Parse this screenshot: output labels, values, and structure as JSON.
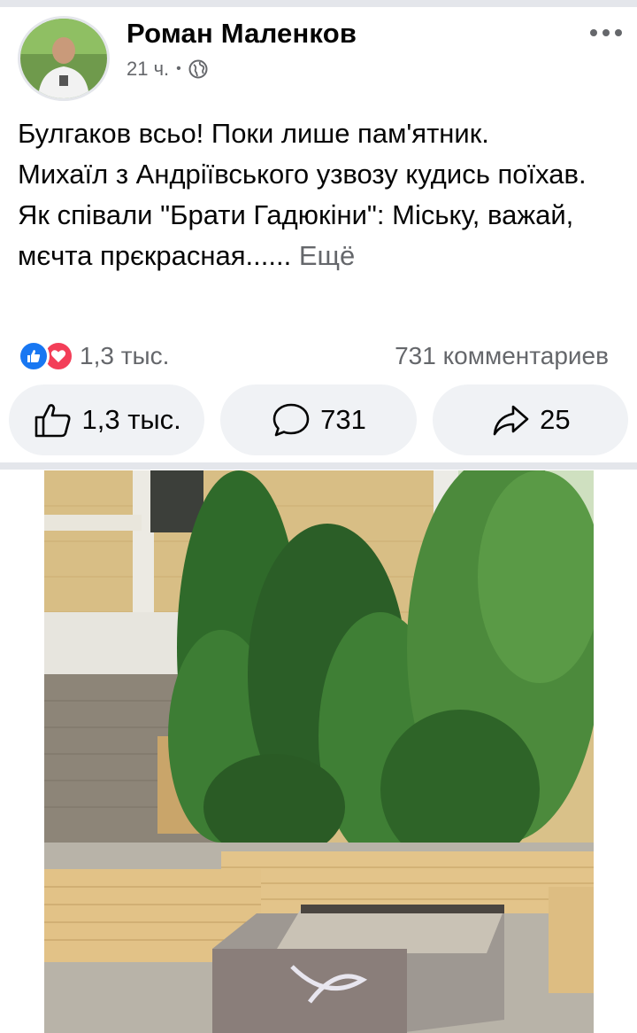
{
  "header": {
    "author_name": "Роман Маленков",
    "time": "21 ч.",
    "separator": "•",
    "privacy_icon": "globe-icon",
    "more_icon": "more-options-icon"
  },
  "post": {
    "lines": [
      "Булгаков всьо! Поки лише пам'ятник.",
      "Михаїл з Андріївського узвозу кудись поїхав.",
      "Як співали \"Брати Гадюкіни\": Міську, важай, мєчта прєкрасная......"
    ],
    "see_more": "Ещё"
  },
  "stats": {
    "reaction_icons": [
      "like-reaction-icon",
      "love-reaction-icon"
    ],
    "reactions_count": "1,3 тыс.",
    "comments_count": "731 комментариев"
  },
  "actions": {
    "like_count": "1,3 тыс.",
    "comment_count": "731",
    "share_count": "25"
  },
  "colors": {
    "brand_blue": "#1877f2",
    "love_red": "#f33e58",
    "muted_text": "#65676b",
    "button_bg": "#f0f2f5"
  }
}
